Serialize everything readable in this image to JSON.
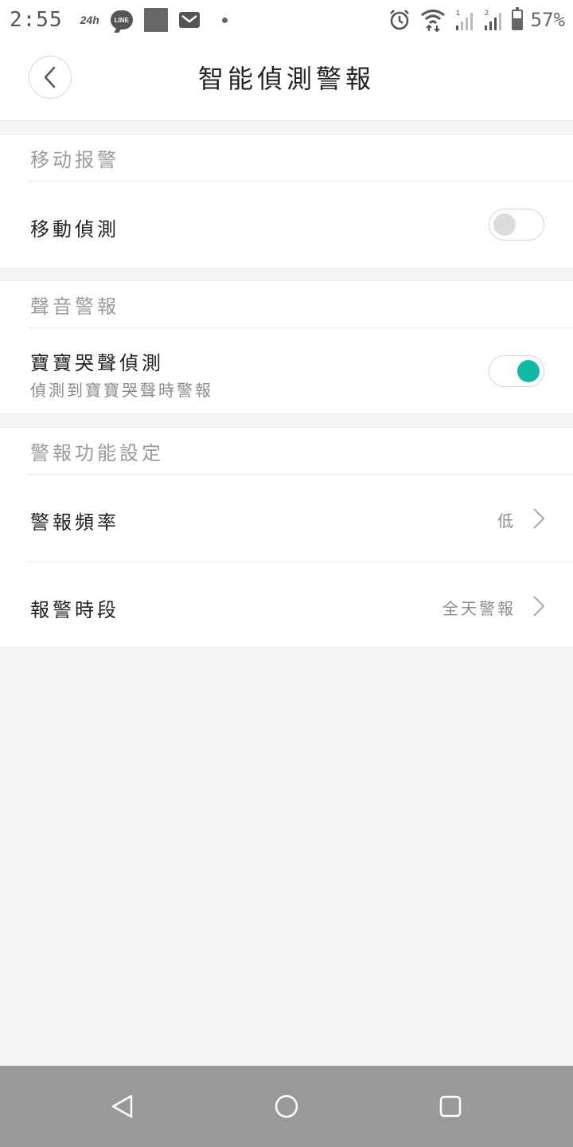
{
  "status_bar": {
    "time": "2:55",
    "indicator_24h": "24h",
    "line_app_label": "LINE",
    "battery_percent": "57%",
    "battery_level": 0.57
  },
  "header": {
    "title": "智能偵測警報"
  },
  "sections": {
    "motion": {
      "title": "移动报警",
      "rows": {
        "motion_detection": {
          "label": "移動偵測",
          "toggle_state": "off"
        }
      }
    },
    "sound": {
      "title": "聲音警報",
      "rows": {
        "baby_cry": {
          "label": "寶寶哭聲偵測",
          "sublabel": "偵測到寶寶哭聲時警報",
          "toggle_state": "on"
        }
      }
    },
    "alert_settings": {
      "title": "警報功能設定",
      "rows": {
        "frequency": {
          "label": "警報頻率",
          "value": "低"
        },
        "schedule": {
          "label": "報警時段",
          "value": "全天警報"
        }
      }
    }
  },
  "colors": {
    "accent": "#14b8a6",
    "nav_bar": "#999999",
    "background": "#f4f4f4"
  }
}
